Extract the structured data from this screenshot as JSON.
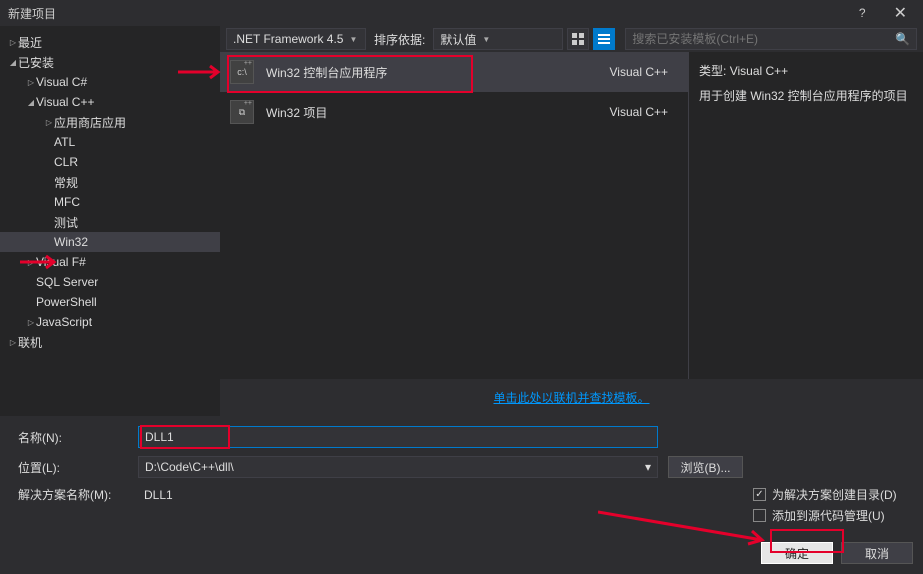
{
  "titlebar": {
    "title": "新建项目"
  },
  "sidebar": {
    "recent": "最近",
    "installed": "已安装",
    "nodes": {
      "vcsharp": "Visual C#",
      "vcpp": "Visual C++",
      "appstore": "应用商店应用",
      "atl": "ATL",
      "clr": "CLR",
      "general": "常规",
      "mfc": "MFC",
      "test": "测试",
      "win32": "Win32",
      "vfsharp": "Visual F#",
      "sql": "SQL Server",
      "ps": "PowerShell",
      "js": "JavaScript"
    },
    "online": "联机"
  },
  "toolbar": {
    "framework": ".NET Framework 4.5",
    "sortby_label": "排序依据:",
    "sortby_value": "默认值",
    "search_placeholder": "搜索已安装模板(Ctrl+E)"
  },
  "templates": [
    {
      "name": "Win32 控制台应用程序",
      "lang": "Visual C++"
    },
    {
      "name": "Win32 项目",
      "lang": "Visual C++"
    }
  ],
  "desc": {
    "type_label": "类型:",
    "type_value": "Visual C++",
    "text": "用于创建  Win32 控制台应用程序的项目"
  },
  "online_link": "单击此处以联机并查找模板。",
  "form": {
    "name_label": "名称(N):",
    "name_value": "DLL1",
    "location_label": "位置(L):",
    "location_value": "D:\\Code\\C++\\dll\\",
    "solution_label": "解决方案名称(M):",
    "solution_value": "DLL1",
    "browse_btn": "浏览(B)...",
    "create_dir_label": "为解决方案创建目录(D)",
    "add_scm_label": "添加到源代码管理(U)"
  },
  "buttons": {
    "ok": "确定",
    "cancel": "取消"
  }
}
